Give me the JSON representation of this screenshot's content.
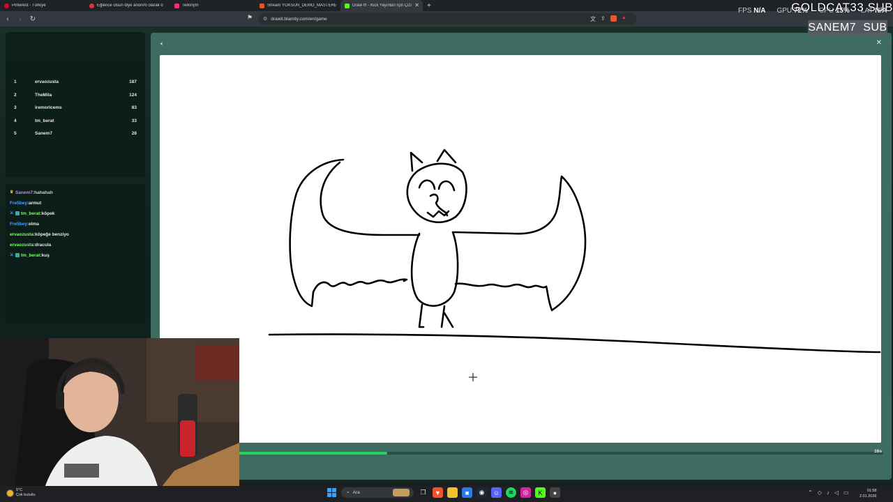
{
  "browser": {
    "tabs": [
      {
        "title": "Pinterest - Türkiye",
        "color": "#e60023",
        "active": false
      },
      {
        "title": "Eğlence olsun diye anonim olarak ö",
        "color": "#d33",
        "active": false
      },
      {
        "title": "Tellonym",
        "color": "#ff2a6d",
        "active": false
      },
      {
        "title": "Stream YOKSUN_DEMO_MASTERED",
        "color": "#f25022",
        "active": false
      },
      {
        "title": "Draw It! - Kick Yayınları İçin Çizim",
        "color": "#53fc18",
        "active": true
      }
    ],
    "url": "drawit.blamity.com/en/game"
  },
  "overlay": {
    "fps_label": "FPS",
    "fps_value": "N/A",
    "gpu_label": "GPU",
    "gpu_value": "72%",
    "cpu_label": "CPU",
    "cpu_value": "15%",
    "lat_label": "LAT",
    "lat_value": "N/A",
    "goldcat": "GOLDCAT33 SUB",
    "sub_name": "SANEM7",
    "sub_tag": "SUB"
  },
  "leaderboard": [
    {
      "rank": "1",
      "name": "ervaozusta",
      "score": "187"
    },
    {
      "rank": "2",
      "name": "TheMila",
      "score": "124"
    },
    {
      "rank": "3",
      "name": "iremoricems",
      "score": "83"
    },
    {
      "rank": "4",
      "name": "tm_berat",
      "score": "33"
    },
    {
      "rank": "5",
      "name": "Sanem7",
      "score": "28"
    }
  ],
  "chat": [
    {
      "user": "Sanem7",
      "message": "hahahah",
      "color": "#c8a8ff",
      "badge": "crown"
    },
    {
      "user": "Fre5bey",
      "message": "armut",
      "color": "#4fa3ff",
      "badge": ""
    },
    {
      "user": "tm_berat",
      "message": "köpek",
      "color": "#7dff6a",
      "badge": "sword"
    },
    {
      "user": "Fre5bey",
      "message": "elma",
      "color": "#4fa3ff",
      "badge": ""
    },
    {
      "user": "ervaozusta",
      "message": "köpeğe benziyo",
      "color": "#7dff6a",
      "badge": ""
    },
    {
      "user": "ervaozusta",
      "message": "dracula",
      "color": "#7dff6a",
      "badge": ""
    },
    {
      "user": "tm_berat",
      "message": "kuş",
      "color": "#7dff6a",
      "badge": "sword"
    }
  ],
  "game": {
    "timer_label": "16s",
    "timer_progress": 0.23
  },
  "taskbar": {
    "weather_temp": "5°C",
    "weather_desc": "Çok bulutlu",
    "search_label": "Ara",
    "time": "01:58",
    "date": "2.01.2026"
  }
}
